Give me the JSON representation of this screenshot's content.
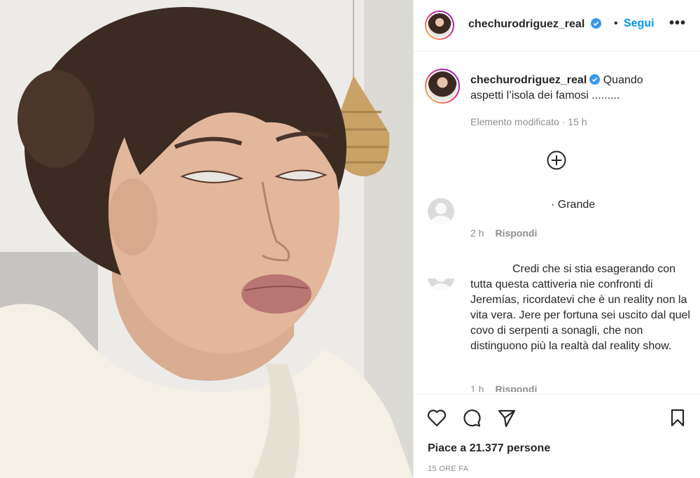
{
  "post": {
    "username": "chechurodriguez_real",
    "follow_label": "Segui",
    "separator": "•",
    "more_label": "•••",
    "caption_line1": "Quando",
    "caption_line2": "aspetti l’isola dei famosi .........",
    "edited_label": "Elemento modificato · 15 h"
  },
  "comments": [
    {
      "text": "· Grande",
      "time": "2 h",
      "reply_label": "Rispondi"
    },
    {
      "text": "Credi che si stia esagerando con tutta questa cattiveria nie confronti di Jeremías, ricordatevi che è un reality non la vita vera. Jere per fortuna sei uscito dal quel covo di serpenti a sonagli, che non distinguono più la realtà dal reality show.",
      "time": "1 h",
      "reply_label": "Rispondi"
    }
  ],
  "footer": {
    "likes": "Piace a 21.377 persone",
    "time": "15 ORE FA"
  },
  "icons": {
    "verified": "verified-badge-icon",
    "more": "more-options-icon",
    "load_more": "add-circle-icon",
    "like": "heart-icon",
    "comment": "comment-icon",
    "share": "paper-plane-icon",
    "save": "bookmark-icon"
  },
  "colors": {
    "accent": "#0095f6",
    "text": "#262626",
    "muted": "#8e8e8e",
    "verified": "#3897f0"
  }
}
